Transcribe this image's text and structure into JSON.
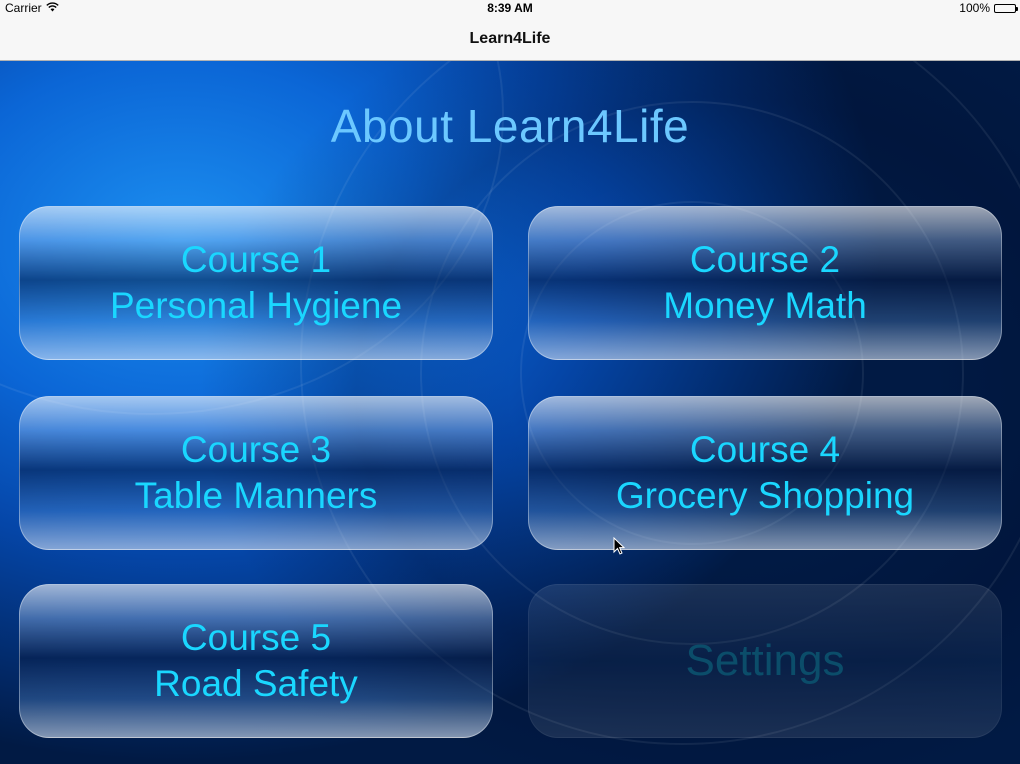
{
  "status_bar": {
    "carrier": "Carrier",
    "time": "8:39 AM",
    "battery": "100%",
    "battery_level": 1.0
  },
  "nav": {
    "title": "Learn4Life"
  },
  "main": {
    "title": "About Learn4Life",
    "buttons": [
      {
        "line1": "Course 1",
        "line2": "Personal Hygiene"
      },
      {
        "line1": "Course 2",
        "line2": "Money Math"
      },
      {
        "line1": "Course 3",
        "line2": "Table Manners"
      },
      {
        "line1": "Course 4",
        "line2": "Grocery Shopping"
      },
      {
        "line1": "Course 5",
        "line2": "Road Safety"
      }
    ],
    "settings_label": "Settings"
  },
  "colors": {
    "title": "#6cc8ff",
    "button_text": "#1ad7ff",
    "settings_text": "#0b4d6a",
    "background": "#0b66d6"
  }
}
